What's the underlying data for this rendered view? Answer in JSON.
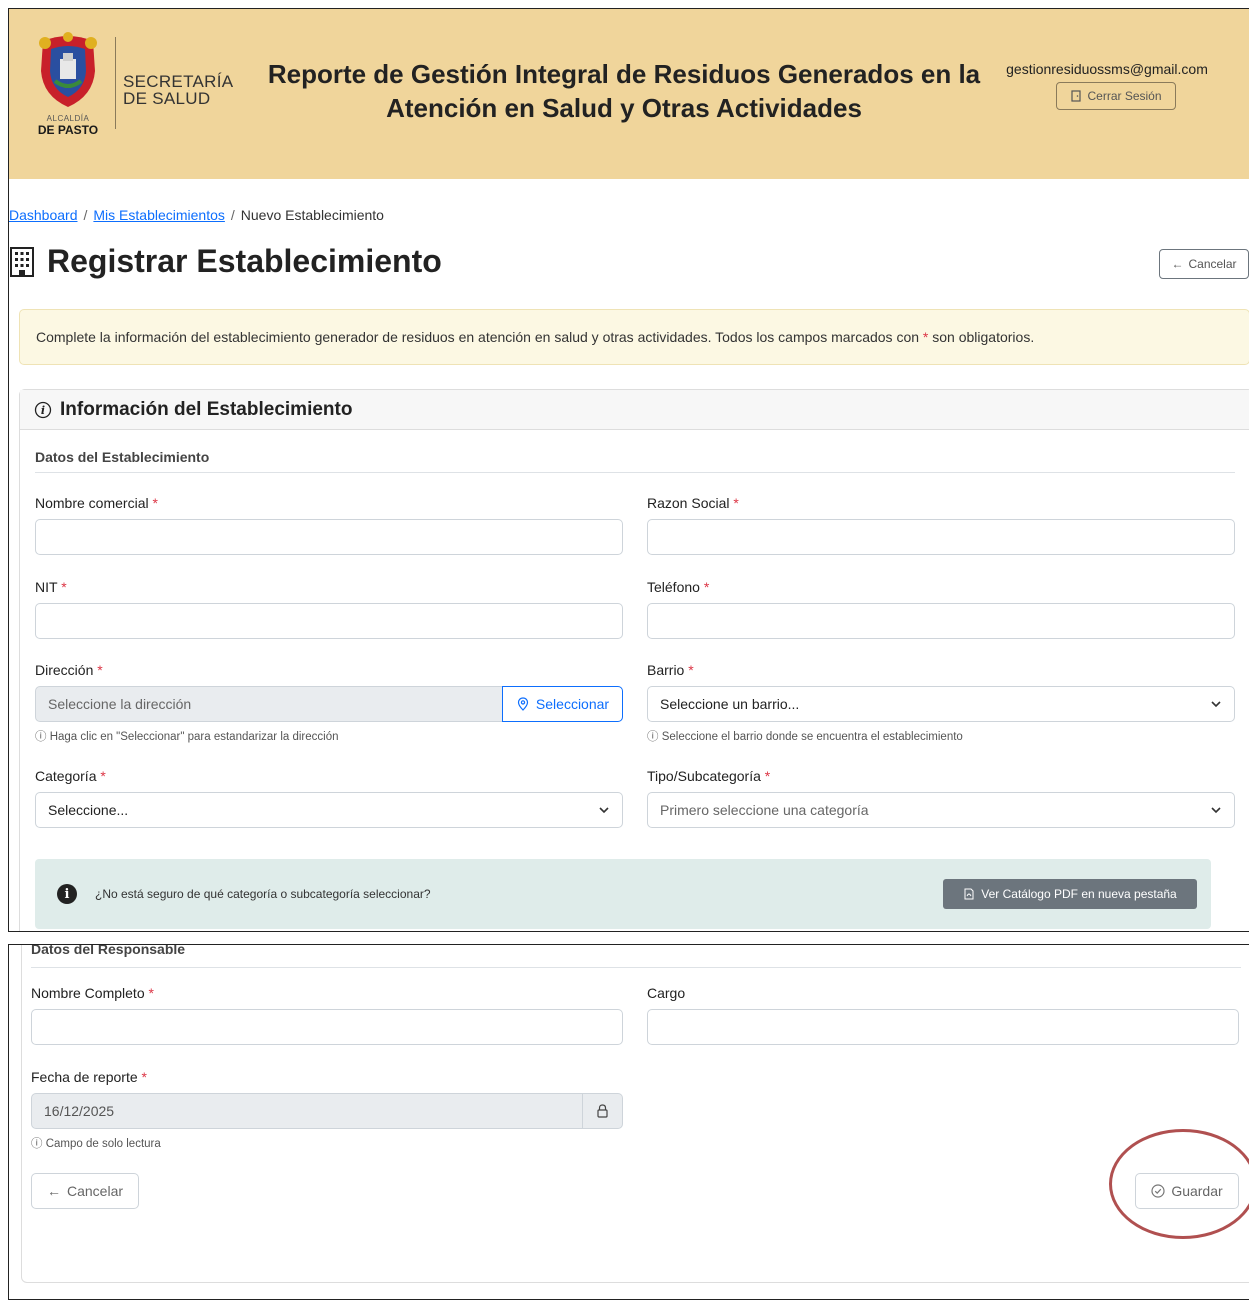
{
  "header": {
    "alcaldia": "ALCALDÍA",
    "de_pasto": "DE PASTO",
    "secretaria_line1": "SECRETARÍA",
    "secretaria_line2": "DE SALUD",
    "title": "Reporte de Gestión Integral de Residuos Generados en la Atención en Salud y Otras Actividades",
    "user_email": "gestionresiduossms@gmail.com",
    "logout_label": "Cerrar Sesión"
  },
  "breadcrumb": {
    "dashboard": "Dashboard",
    "mis_establecimientos": "Mis Establecimientos",
    "current": "Nuevo Establecimiento",
    "separator": "/"
  },
  "page": {
    "title": "Registrar Establecimiento",
    "cancel_label": "Cancelar"
  },
  "alert": {
    "text_before": "Complete la información del establecimiento generador de residuos en atención en salud y otras actividades. Todos los campos marcados con",
    "required_mark": "*",
    "text_after": "son obligatorios."
  },
  "card": {
    "title": "Información del Establecimiento",
    "section_establecimiento": "Datos del Establecimiento",
    "section_responsable": "Datos del Responsable"
  },
  "fields": {
    "required_mark": "*",
    "nombre_comercial": {
      "label": "Nombre comercial",
      "value": ""
    },
    "razon_social": {
      "label": "Razon Social",
      "value": ""
    },
    "nit": {
      "label": "NIT",
      "value": ""
    },
    "telefono": {
      "label": "Teléfono",
      "value": ""
    },
    "direccion": {
      "label": "Dirección",
      "placeholder": "Seleccione la dirección",
      "button_label": "Seleccionar",
      "help": "Haga clic en \"Seleccionar\" para estandarizar la dirección"
    },
    "barrio": {
      "label": "Barrio",
      "selected": "Seleccione un barrio...",
      "help": "Seleccione el barrio donde se encuentra el establecimiento"
    },
    "categoria": {
      "label": "Categoría",
      "selected": "Seleccione..."
    },
    "subcategoria": {
      "label": "Tipo/Subcategoría",
      "selected": "Primero seleccione una categoría"
    },
    "nombre_completo": {
      "label": "Nombre Completo",
      "value": ""
    },
    "cargo": {
      "label": "Cargo",
      "value": ""
    },
    "fecha_reporte": {
      "label": "Fecha de reporte",
      "value": "16/12/2025",
      "help": "Campo de solo lectura"
    }
  },
  "catalog": {
    "question": "¿No está seguro de qué categoría o subcategoría seleccionar?",
    "button_label": "Ver Catálogo PDF en nueva pestaña"
  },
  "actions": {
    "cancel_label": "Cancelar",
    "save_label": "Guardar"
  },
  "colors": {
    "header_bg": "#f0d59b",
    "link": "#0d6efd",
    "required": "#dc3545",
    "highlight": "#b05050"
  }
}
